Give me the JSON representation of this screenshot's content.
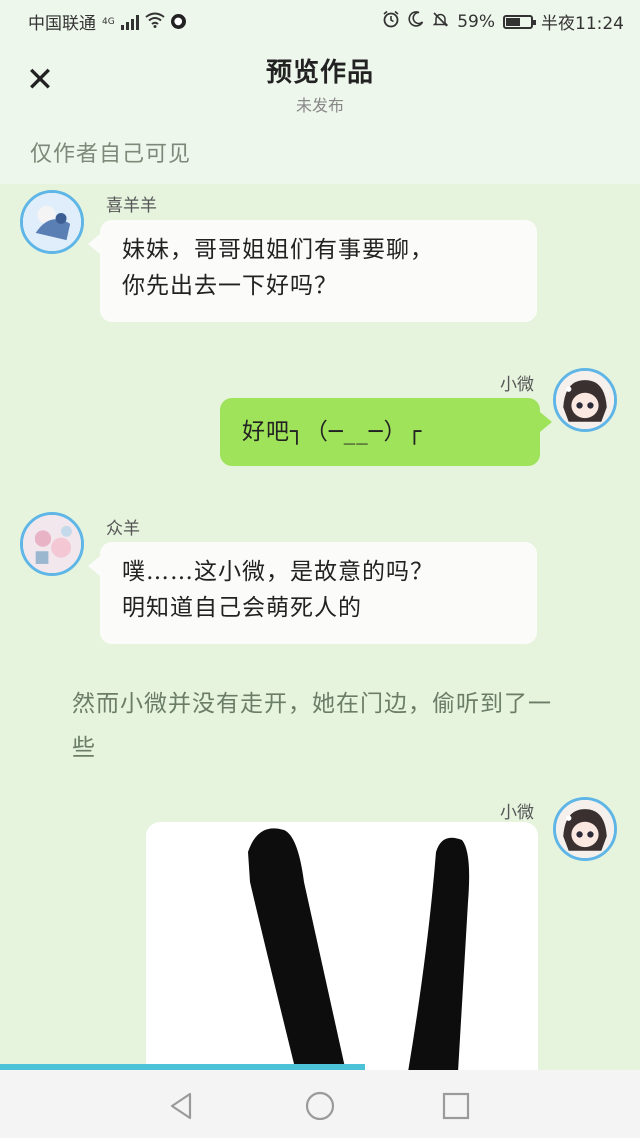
{
  "status_bar": {
    "carrier": "中国联通",
    "network": "4G",
    "battery_percent": "59%",
    "battery_level": 0.59,
    "time": "半夜11:24"
  },
  "header": {
    "title": "预览作品",
    "subtitle": "未发布",
    "close_icon": "close-icon"
  },
  "notice": "仅作者自己可见",
  "messages": [
    {
      "sender": "喜羊羊",
      "side": "left",
      "text": "妹妹，哥哥姐姐们有事要聊，\n你先出去一下好吗？"
    },
    {
      "sender": "小微",
      "side": "right",
      "text": "好吧┐（─__─）┌"
    },
    {
      "sender": "众羊",
      "side": "left",
      "text": "噗……这小微，是故意的吗？\n明知道自己会萌死人的"
    },
    {
      "sender": "小微",
      "side": "right",
      "text": ""
    }
  ],
  "narration": "然而小微并没有走开，她在门边，偷听到了一些",
  "progress": 0.57,
  "nav": {
    "back_icon": "back-triangle-icon",
    "home_icon": "home-circle-icon",
    "recents_icon": "recents-square-icon"
  },
  "colors": {
    "chat_background": "#e6f4de",
    "bubble_self": "#9fe35a",
    "bubble_other": "#fbfcf9",
    "avatar_ring": "#5fb6e6",
    "progress": "#4cc2d9"
  }
}
